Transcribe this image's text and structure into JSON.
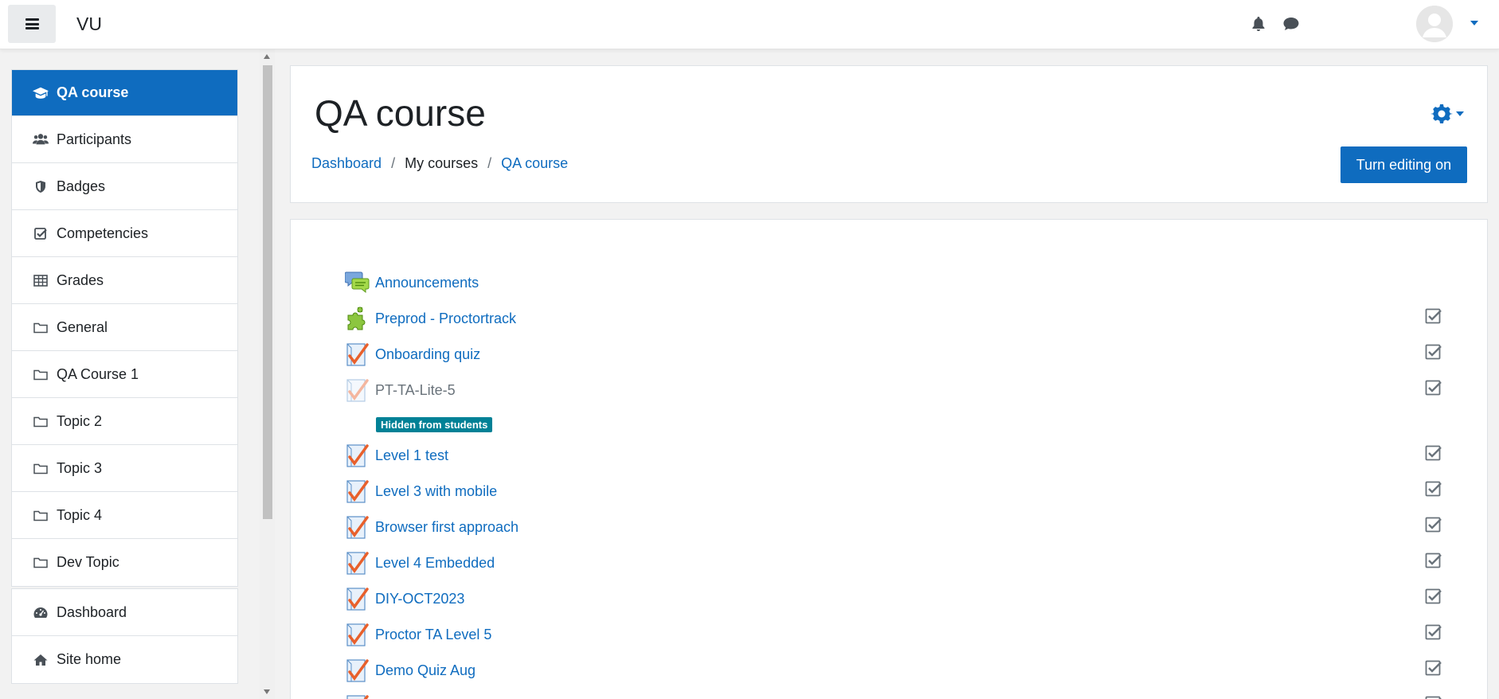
{
  "navbar": {
    "site_name": "VU"
  },
  "sidebar": {
    "items": [
      {
        "label": "QA course",
        "icon": "graduation-cap-icon"
      },
      {
        "label": "Participants",
        "icon": "users-icon"
      },
      {
        "label": "Badges",
        "icon": "shield-icon"
      },
      {
        "label": "Competencies",
        "icon": "check-square-icon"
      },
      {
        "label": "Grades",
        "icon": "table-icon"
      },
      {
        "label": "General",
        "icon": "folder-icon"
      },
      {
        "label": "QA Course 1",
        "icon": "folder-icon"
      },
      {
        "label": "Topic 2",
        "icon": "folder-icon"
      },
      {
        "label": "Topic 3",
        "icon": "folder-icon"
      },
      {
        "label": "Topic 4",
        "icon": "folder-icon"
      },
      {
        "label": "Dev Topic",
        "icon": "folder-icon"
      }
    ],
    "items2": [
      {
        "label": "Dashboard",
        "icon": "dashboard-icon"
      },
      {
        "label": "Site home",
        "icon": "home-icon"
      }
    ]
  },
  "header": {
    "title": "QA course",
    "breadcrumb": {
      "dashboard": "Dashboard",
      "my_courses": "My courses",
      "course": "QA course",
      "separator": "/"
    },
    "edit_button": "Turn editing on"
  },
  "activities": [
    {
      "name": "Announcements",
      "type": "forum"
    },
    {
      "name": "Preprod - Proctortrack",
      "type": "lti"
    },
    {
      "name": "Onboarding quiz",
      "type": "quiz"
    },
    {
      "name": "PT-TA-Lite-5",
      "type": "quiz-hidden"
    },
    {
      "name": "Level 1 test",
      "type": "quiz"
    },
    {
      "name": "Level 3 with mobile",
      "type": "quiz"
    },
    {
      "name": "Browser first approach",
      "type": "quiz"
    },
    {
      "name": "Level 4 Embedded",
      "type": "quiz"
    },
    {
      "name": "DIY-OCT2023",
      "type": "quiz"
    },
    {
      "name": "Proctor TA Level 5",
      "type": "quiz"
    },
    {
      "name": "Demo Quiz Aug",
      "type": "quiz"
    }
  ],
  "hidden_badge": "Hidden from students",
  "colors": {
    "brand": "#0f6cbf",
    "hidden_badge": "#008196"
  }
}
